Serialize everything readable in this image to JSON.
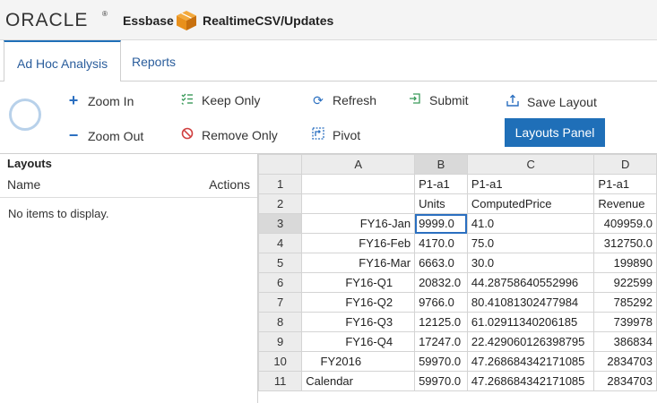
{
  "header": {
    "logo_text": "ORACLE",
    "logo_tm": "®",
    "product": "Essbase",
    "app_title": "RealtimeCSV/Updates",
    "cube_color": "#e8901c"
  },
  "tabs": [
    {
      "label": "Ad Hoc Analysis",
      "active": true
    },
    {
      "label": "Reports",
      "active": false
    }
  ],
  "toolbar": {
    "zoom_in": "Zoom In",
    "zoom_out": "Zoom Out",
    "keep_only": "Keep Only",
    "remove_only": "Remove Only",
    "refresh": "Refresh",
    "pivot": "Pivot",
    "submit": "Submit",
    "save_layout": "Save Layout",
    "layouts_panel": "Layouts Panel"
  },
  "layouts_panel": {
    "title": "Layouts",
    "col_name": "Name",
    "col_actions": "Actions",
    "empty_text": "No items to display."
  },
  "grid": {
    "col_headers": [
      "A",
      "B",
      "C",
      "D"
    ],
    "rows": [
      {
        "n": "1",
        "a": "",
        "b": "P1-a1",
        "c": "P1-a1",
        "d": "P1-a1"
      },
      {
        "n": "2",
        "a": "",
        "b": "Units",
        "c": "ComputedPrice",
        "d": "Revenue"
      },
      {
        "n": "3",
        "a": "FY16-Jan",
        "b": "9999.0",
        "c": "41.0",
        "d": "409959.0"
      },
      {
        "n": "4",
        "a": "FY16-Feb",
        "b": "4170.0",
        "c": "75.0",
        "d": "312750.0"
      },
      {
        "n": "5",
        "a": "FY16-Mar",
        "b": "6663.0",
        "c": "30.0",
        "d": "199890"
      },
      {
        "n": "6",
        "a": "FY16-Q1",
        "b": "20832.0",
        "c": "44.28758640552996",
        "d": "922599"
      },
      {
        "n": "7",
        "a": "FY16-Q2",
        "b": "9766.0",
        "c": "80.41081302477984",
        "d": "785292"
      },
      {
        "n": "8",
        "a": "FY16-Q3",
        "b": "12125.0",
        "c": "61.02911340206185",
        "d": "739978"
      },
      {
        "n": "9",
        "a": "FY16-Q4",
        "b": "17247.0",
        "c": "22.429060126398795",
        "d": "386834"
      },
      {
        "n": "10",
        "a": "FY2016",
        "b": "59970.0",
        "c": "47.268684342171085",
        "d": "2834703"
      },
      {
        "n": "11",
        "a": "Calendar",
        "b": "59970.0",
        "c": "47.268684342171085",
        "d": "2834703"
      }
    ]
  }
}
